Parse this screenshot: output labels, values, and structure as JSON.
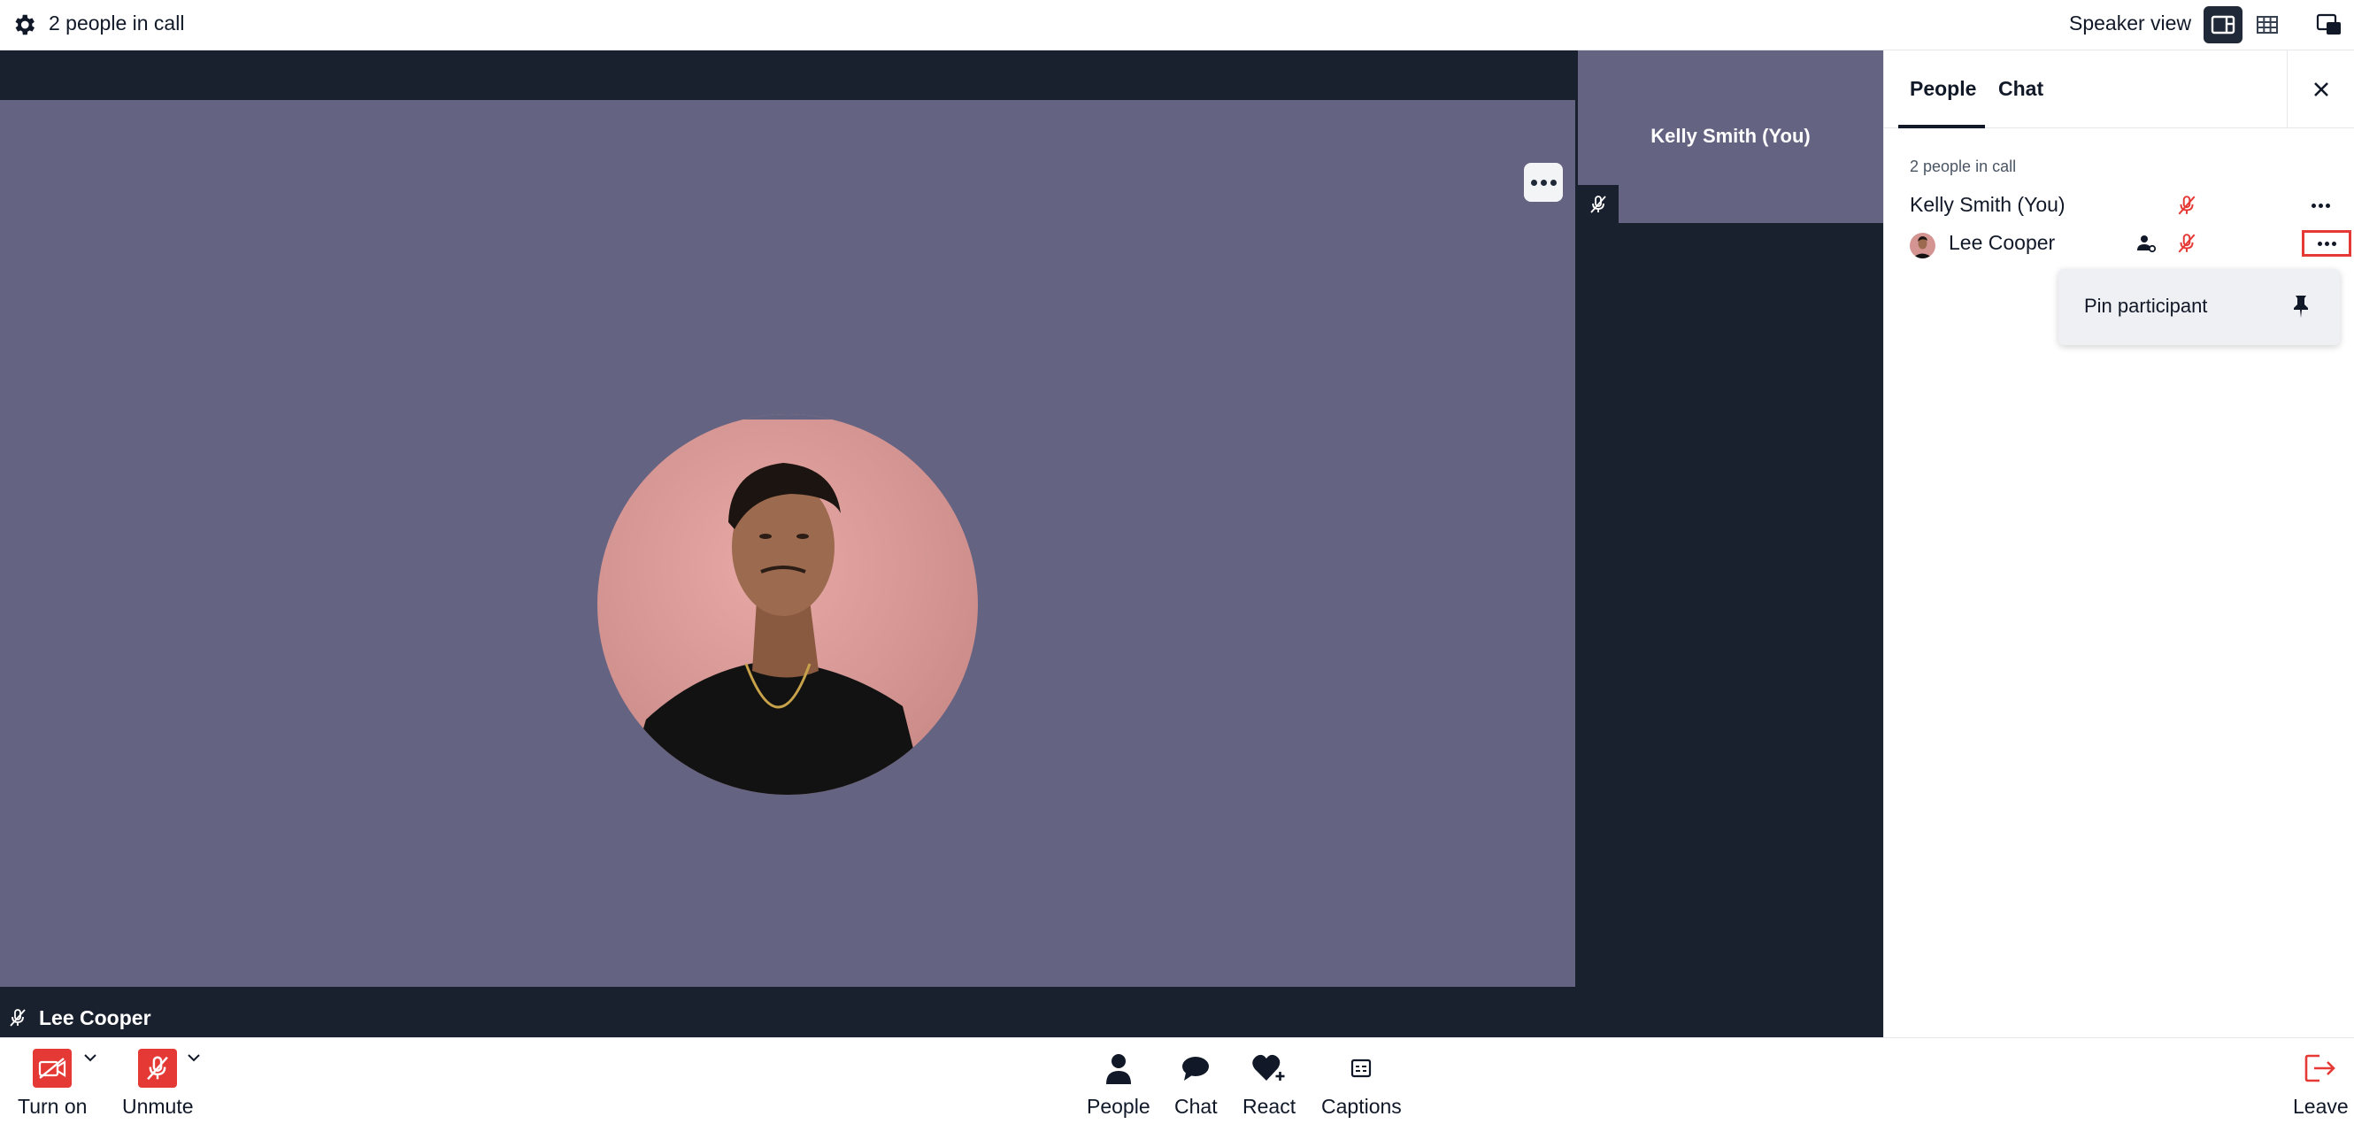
{
  "topbar": {
    "participant_count": "2 people in call",
    "view_label": "Speaker view",
    "icons": [
      "gear-icon",
      "speaker-view-icon",
      "grid-view-icon",
      "popout-icon"
    ]
  },
  "stage": {
    "main_participant": "Lee Cooper",
    "self_tile_name": "Kelly Smith (You)",
    "tile_more_icon": "more-dots-icon",
    "muted_icon": "mic-off-icon"
  },
  "panel": {
    "tabs": [
      {
        "label": "People",
        "active": true
      },
      {
        "label": "Chat",
        "active": false
      }
    ],
    "count_label": "2 people in call",
    "participants": [
      {
        "name": "Kelly Smith (You)",
        "muted": true
      },
      {
        "name": "Lee Cooper",
        "muted": true,
        "has_avatar": true
      }
    ],
    "context_menu": {
      "item_label": "Pin participant",
      "item_icon": "pin-icon"
    }
  },
  "bottombar": {
    "camera_label": "Turn on",
    "mic_label": "Unmute",
    "people_label": "People",
    "chat_label": "Chat",
    "react_label": "React",
    "captions_label": "Captions",
    "leave_label": "Leave"
  },
  "colors": {
    "accent_red": "#e53935",
    "stage_dark": "#1a212e",
    "tile_purple": "#646381"
  }
}
